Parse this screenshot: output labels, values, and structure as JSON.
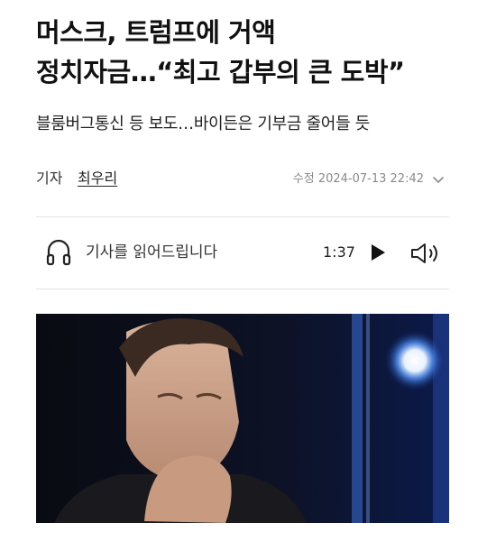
{
  "article": {
    "headline_line1": "머스크, 트럼프에 거액",
    "headline_line2": "정치자금…“최고 갑부의 큰 도박”",
    "subtitle": "블룸버그통신 등 보도…바이든은 기부금 줄어들 듯"
  },
  "byline": {
    "reporter_label": "기자",
    "reporter_name": "최우리",
    "modified_label": "수정",
    "modified_datetime": "2024-07-13 22:42"
  },
  "tts": {
    "label": "기사를 읽어드립니다",
    "duration": "1:37"
  },
  "colors": {
    "text": "#111111",
    "muted": "#8a8a8a",
    "divider": "#e4e4e4"
  },
  "icons": [
    "chevron-down-icon",
    "headphones-icon",
    "play-icon",
    "volume-icon"
  ]
}
